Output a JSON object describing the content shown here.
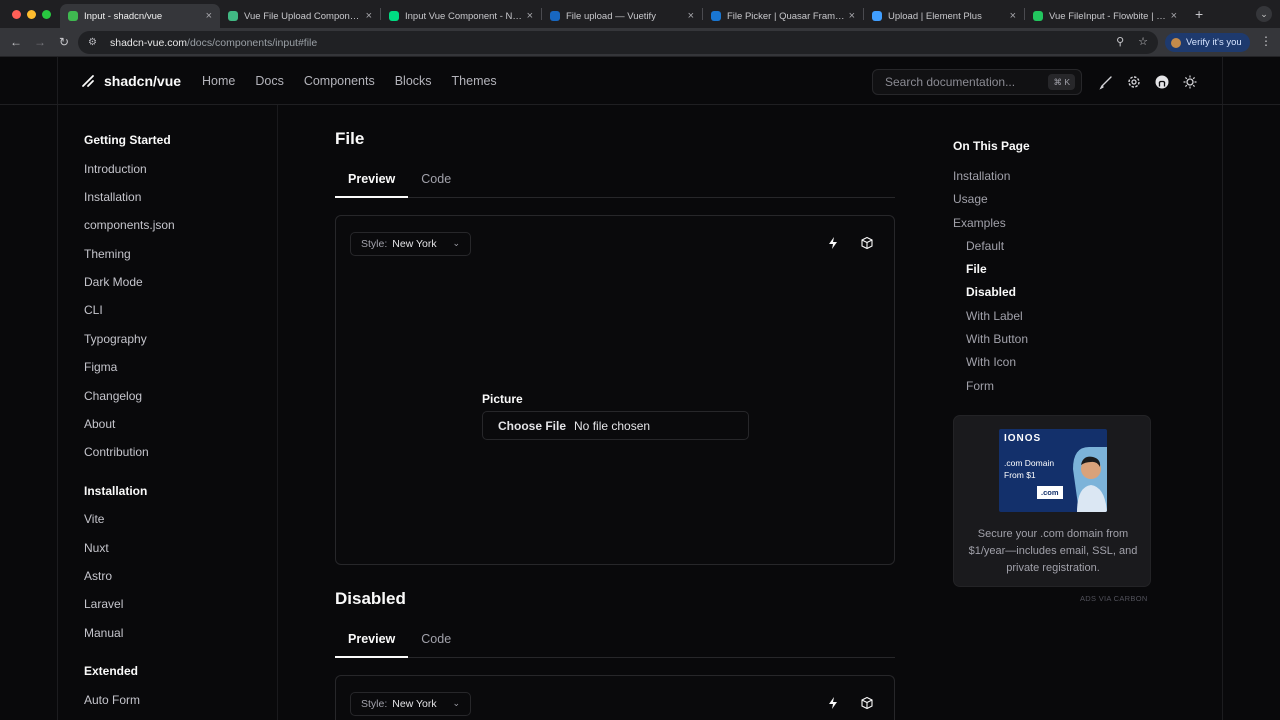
{
  "browser": {
    "tabs": [
      {
        "title": "Input - shadcn/vue",
        "active": true
      },
      {
        "title": "Vue File Upload Component",
        "active": false
      },
      {
        "title": "Input Vue Component - Nuxt",
        "active": false
      },
      {
        "title": "File upload — Vuetify",
        "active": false
      },
      {
        "title": "File Picker | Quasar Framework",
        "active": false
      },
      {
        "title": "Upload | Element Plus",
        "active": false
      },
      {
        "title": "Vue FileInput - Flowbite | Flow",
        "active": false
      }
    ],
    "url_host": "shadcn-vue.com",
    "url_path": "/docs/components/input#file",
    "verify_label": "Verify it's you"
  },
  "header": {
    "logo_text": "shadcn/vue",
    "nav": [
      "Home",
      "Docs",
      "Components",
      "Blocks",
      "Themes"
    ],
    "search_placeholder": "Search documentation...",
    "search_shortcut": "⌘ K"
  },
  "sidebar": {
    "sections": [
      {
        "heading": "Getting Started",
        "items": [
          "Introduction",
          "Installation",
          "components.json",
          "Theming",
          "Dark Mode",
          "CLI",
          "Typography",
          "Figma",
          "Changelog",
          "About",
          "Contribution"
        ]
      },
      {
        "heading": "Installation",
        "items": [
          "Vite",
          "Nuxt",
          "Astro",
          "Laravel",
          "Manual"
        ]
      },
      {
        "heading": "Extended",
        "items": [
          "Auto Form"
        ]
      }
    ]
  },
  "main": {
    "file_section": {
      "title": "File",
      "tabs": [
        "Preview",
        "Code"
      ],
      "style_label": "Style:",
      "style_value": "New York",
      "field_label": "Picture",
      "choose_button": "Choose File",
      "no_file_text": "No file chosen"
    },
    "disabled_section": {
      "title": "Disabled",
      "tabs": [
        "Preview",
        "Code"
      ],
      "style_label": "Style:",
      "style_value": "New York"
    }
  },
  "toc": {
    "heading": "On This Page",
    "items": [
      {
        "label": "Installation",
        "sub": false,
        "current": false
      },
      {
        "label": "Usage",
        "sub": false,
        "current": false
      },
      {
        "label": "Examples",
        "sub": false,
        "current": false
      },
      {
        "label": "Default",
        "sub": true,
        "current": false
      },
      {
        "label": "File",
        "sub": true,
        "current": true
      },
      {
        "label": "Disabled",
        "sub": true,
        "current": true
      },
      {
        "label": "With Label",
        "sub": true,
        "current": false
      },
      {
        "label": "With Button",
        "sub": true,
        "current": false
      },
      {
        "label": "With Icon",
        "sub": true,
        "current": false
      },
      {
        "label": "Form",
        "sub": true,
        "current": false
      }
    ]
  },
  "ad": {
    "brand": "IONOS",
    "image_line1": ".com Domain",
    "image_line2": "From $1",
    "image_badge": ".com",
    "text": "Secure your .com domain from $1/year—includes email, SSL, and private registration.",
    "via": "ADS VIA CARBON"
  }
}
